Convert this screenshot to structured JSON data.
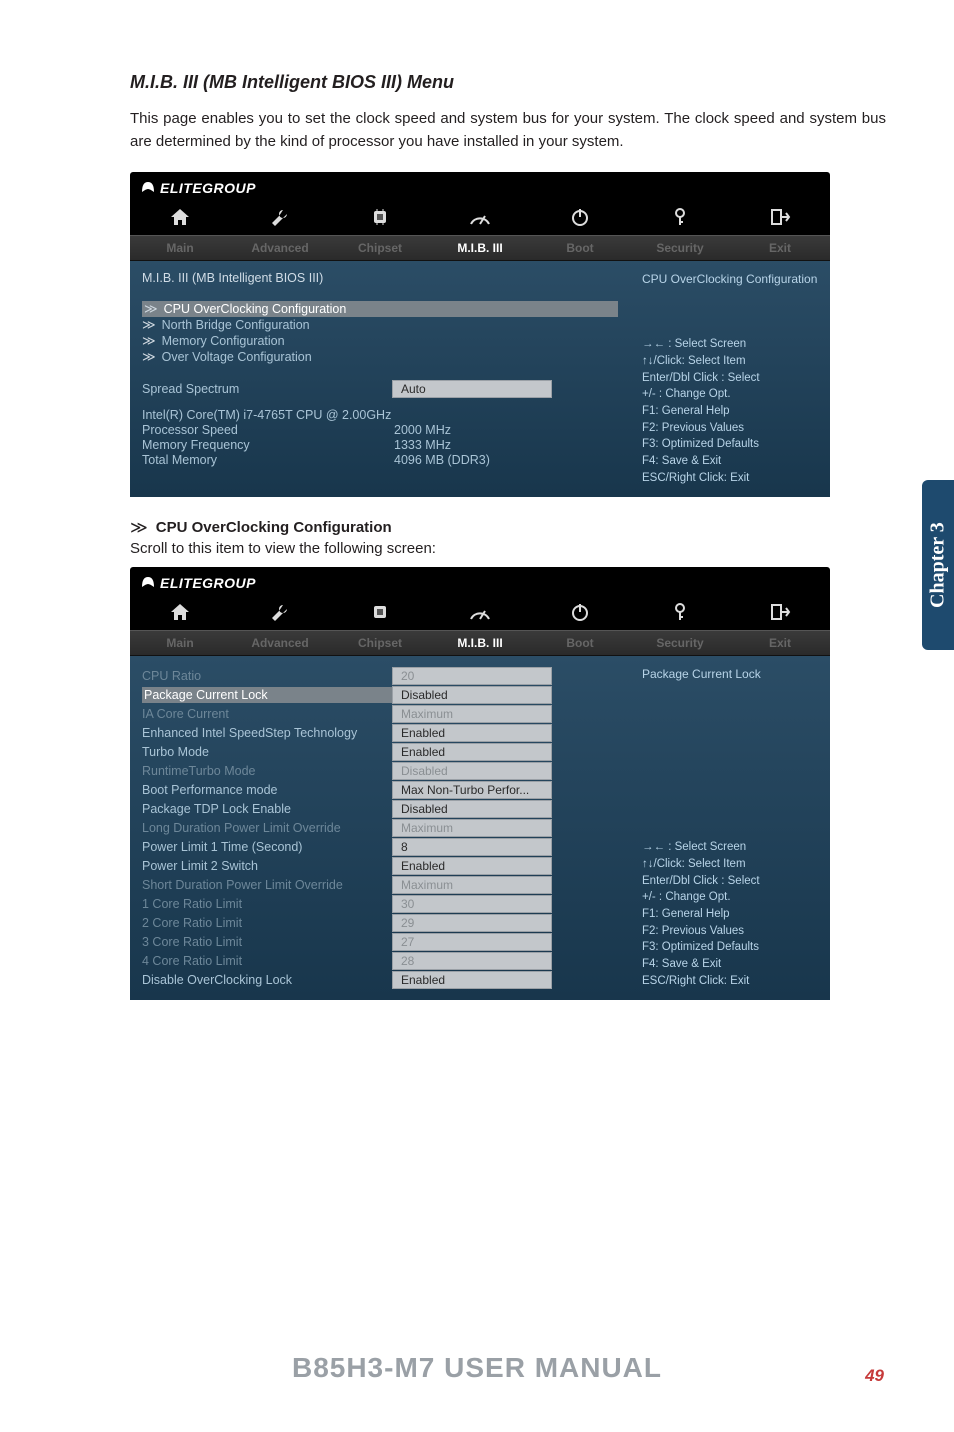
{
  "page": {
    "heading": "M.I.B. III (MB Intelligent BIOS III) Menu",
    "intro": "This page enables you to set the clock speed and system bus for your system. The clock speed and system bus are determined by the kind of processor you have installed in your system.",
    "sideTab": "Chapter 3",
    "footer": "B85H3-M7 USER MANUAL",
    "pageNum": "49"
  },
  "brand": "ELITEGROUP",
  "tabs": [
    "Main",
    "Advanced",
    "Chipset",
    "M.I.B. III",
    "Boot",
    "Security",
    "Exit"
  ],
  "bios1": {
    "subhead": "M.I.B. III (MB Intelligent BIOS III)",
    "menu": [
      "CPU OverClocking Configuration",
      "North Bridge Configuration",
      "Memory Configuration",
      "Over Voltage Configuration"
    ],
    "spread": {
      "label": "Spread Spectrum",
      "value": "Auto"
    },
    "cpuLine": "Intel(R) Core(TM) i7-4765T CPU @ 2.00GHz",
    "ps": {
      "label": "Processor Speed",
      "value": "2000 MHz"
    },
    "mf": {
      "label": "Memory Frequency",
      "value": "1333 MHz"
    },
    "tm": {
      "label": "Total Memory",
      "value": "4096 MB (DDR3)"
    },
    "helpTop": "CPU OverClocking Configuration",
    "helpBottom": "→←   : Select Screen\n↑↓/Click: Select Item\nEnter/Dbl Click : Select\n+/- : Change Opt.\nF1: General Help\nF2: Previous Values\nF3: Optimized Defaults\nF4: Save & Exit\nESC/Right Click: Exit"
  },
  "section2": {
    "title": "CPU OverClocking Configuration",
    "desc": "Scroll to this item to view the following screen:"
  },
  "bios2": {
    "rows": [
      {
        "label": "CPU Ratio",
        "value": "20",
        "dim": true
      },
      {
        "label": "Package Current Lock",
        "value": "Disabled",
        "sel": true
      },
      {
        "label": "IA Core Current",
        "value": "Maximum",
        "dim": true
      },
      {
        "label": "Enhanced Intel SpeedStep Technology",
        "value": "Enabled"
      },
      {
        "label": "Turbo Mode",
        "value": "Enabled"
      },
      {
        "label": "RuntimeTurbo Mode",
        "value": "Disabled",
        "dim": true
      },
      {
        "label": "Boot Performance mode",
        "value": "Max Non-Turbo Perfor..."
      },
      {
        "label": "Package TDP Lock Enable",
        "value": "Disabled"
      },
      {
        "label": "Long Duration Power Limit Override",
        "value": "Maximum",
        "dim": true
      },
      {
        "label": "Power Limit 1 Time (Second)",
        "value": "8"
      },
      {
        "label": "Power Limit 2 Switch",
        "value": "Enabled"
      },
      {
        "label": "Short Duration Power Limit Override",
        "value": "Maximum",
        "dim": true
      },
      {
        "label": "1 Core Ratio Limit",
        "value": "30",
        "dim": true
      },
      {
        "label": "2 Core Ratio Limit",
        "value": "29",
        "dim": true
      },
      {
        "label": "3 Core Ratio Limit",
        "value": "27",
        "dim": true
      },
      {
        "label": "4 Core Ratio Limit",
        "value": "28",
        "dim": true
      },
      {
        "label": "Disable OverClocking Lock",
        "value": "Enabled"
      }
    ],
    "helpTop": "Package Current Lock",
    "helpBottom": "→←   : Select Screen\n↑↓/Click: Select Item\nEnter/Dbl Click : Select\n+/- : Change Opt.\nF1: General Help\nF2: Previous Values\nF3: Optimized Defaults\nF4: Save & Exit\nESC/Right Click: Exit"
  }
}
